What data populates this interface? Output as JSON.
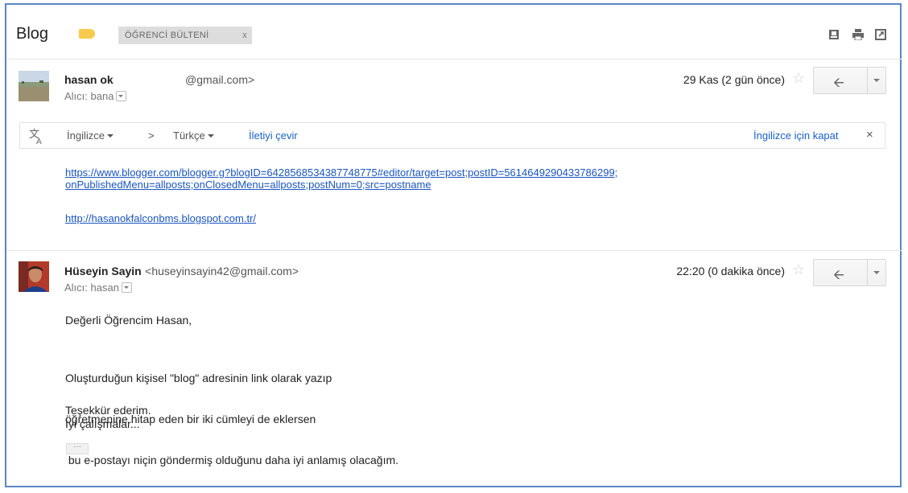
{
  "thread": {
    "subject": "Blog",
    "label": "ÖĞRENCİ BÜLTENİ",
    "label_close": "x",
    "label_color": "#f7cb4d",
    "actions": [
      "download-icon",
      "print-icon",
      "new-window-icon"
    ]
  },
  "message1": {
    "sender_name": "hasan ok",
    "sender_email": "@gmail.com>",
    "to": "Alıcı: bana",
    "date": "29 Kas (2 gün önce)",
    "star": "☆",
    "reply_icon": "reply-arrow-icon",
    "links": [
      "https://www.blogger.com/blogger.g?blogID=6428568534387748775#editor/target=post;postID=5614649290433786299;",
      "onPublishedMenu=allposts;onClosedMenu=allposts;postNum=0;src=postname",
      "http://hasanokfalconbms.blogspot.com.tr/"
    ]
  },
  "translate": {
    "icon": "translate-icon",
    "from_lang": "İngilizce",
    "arrow": ">",
    "to_lang": "Türkçe",
    "translate_link": "İletiyi çevir",
    "turn_off": "İngilizce için kapat",
    "close": "×"
  },
  "message2": {
    "sender_name": "Hüseyin Sayin",
    "sender_email": "<huseyinsayin42@gmail.com>",
    "to": "Alıcı: hasan",
    "date": "22:20 (0 dakika önce)",
    "star": "☆",
    "greeting": "Değerli Öğrencim Hasan,",
    "para1": [
      "Oluşturduğun kişisel \"blog\" adresinin link olarak yazıp",
      "öğretmenine hitap eden bir iki cümleyi de eklersen",
      " bu e-postayı niçin göndermiş olduğunu daha iyi anlamış olacağım."
    ],
    "thanks": "Teşekkür ederim.",
    "closing": "İyi çalışmalar...",
    "trimmed": "···"
  }
}
